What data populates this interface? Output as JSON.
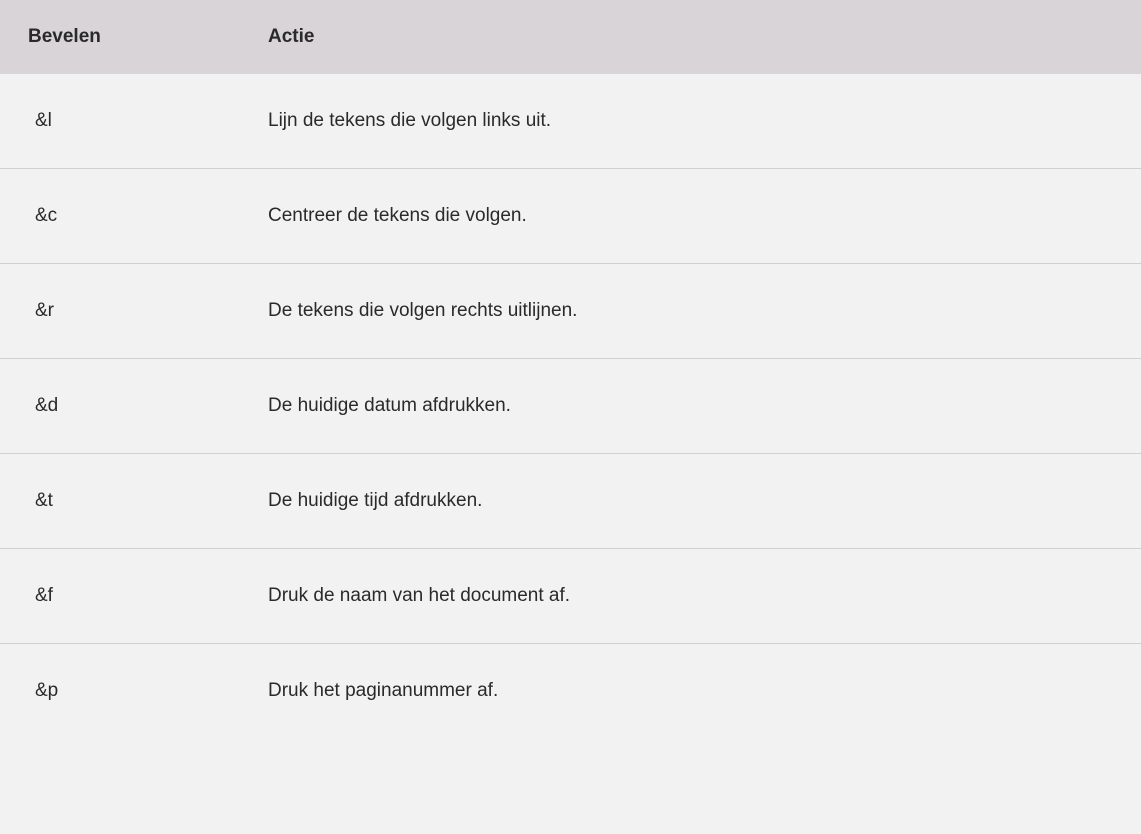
{
  "headers": {
    "command": "Bevelen",
    "action": "Actie"
  },
  "rows": [
    {
      "command": "&l",
      "action": "Lijn de tekens die volgen links uit."
    },
    {
      "command": "&c",
      "action": "Centreer de tekens die volgen."
    },
    {
      "command": "&r",
      "action": "De tekens die volgen rechts uitlijnen."
    },
    {
      "command": "&d",
      "action": "De huidige datum afdrukken."
    },
    {
      "command": "&t",
      "action": "De huidige tijd afdrukken."
    },
    {
      "command": "&f",
      "action": "Druk de naam van het document af."
    },
    {
      "command": "&p",
      "action": "Druk het paginanummer af."
    }
  ]
}
